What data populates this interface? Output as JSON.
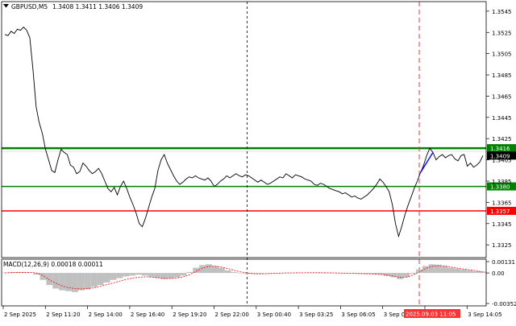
{
  "symbol_info": "GBPUSD,M5",
  "ohlc": "1.3408 1.3411 1.3406 1.3409",
  "macd_label": "MACD(12,26,9) 0.00018 0.00011",
  "colors": {
    "price": "#000000",
    "green_level": "#008000",
    "red_level": "#ff0000",
    "vline_red": "#ff3333",
    "vline_black": "#000000",
    "macd_hist": "#c0c0c0",
    "macd_signal": "#ff0000",
    "blue_segment": "#1a1aff",
    "axis_bg": "#ffffff"
  },
  "chart_data": [
    {
      "type": "line",
      "name": "price",
      "ylim": [
        1.3313,
        1.3554
      ],
      "y_ticks": [
        "1.3545",
        "1.3525",
        "1.3505",
        "1.3485",
        "1.3465",
        "1.3445",
        "1.3425",
        "1.3405",
        "1.3385",
        "1.3365",
        "1.3345",
        "1.3325"
      ],
      "x_ticks": [
        "2 Sep 2025",
        "2 Sep 11:20",
        "2 Sep 14:00",
        "2 Sep 16:40",
        "2 Sep 19:20",
        "2 Sep 22:00",
        "3 Sep 00:40",
        "3 Sep 03:25",
        "3 Sep 06:05",
        "3 Sep 08:45",
        "3 Sep 11:25",
        "3 Sep 14:05"
      ],
      "current_time_label": "2025.09.03 11:05",
      "levels": [
        {
          "label": "1.3416",
          "value": 1.3416,
          "color": "green"
        },
        {
          "label": "1.3380",
          "value": 1.338,
          "color": "green"
        },
        {
          "label": "1.3357",
          "value": 1.3357,
          "color": "red"
        }
      ],
      "current_price_label": "1.3409",
      "close_values": [
        1.3523,
        1.3522,
        1.3526,
        1.3524,
        1.3528,
        1.3527,
        1.353,
        1.3527,
        1.352,
        1.349,
        1.3455,
        1.344,
        1.343,
        1.3415,
        1.3405,
        1.3395,
        1.3393,
        1.3405,
        1.3415,
        1.3412,
        1.341,
        1.34,
        1.3398,
        1.3392,
        1.3394,
        1.3402,
        1.3399,
        1.3395,
        1.3392,
        1.3394,
        1.3397,
        1.3392,
        1.3385,
        1.3378,
        1.3375,
        1.3379,
        1.3372,
        1.338,
        1.3385,
        1.3378,
        1.337,
        1.3363,
        1.3355,
        1.3345,
        1.3342,
        1.335,
        1.336,
        1.337,
        1.3378,
        1.3395,
        1.3405,
        1.341,
        1.3402,
        1.3396,
        1.339,
        1.3385,
        1.3382,
        1.3384,
        1.3387,
        1.3389,
        1.3388,
        1.339,
        1.3388,
        1.3387,
        1.3386,
        1.3388,
        1.3385,
        1.338,
        1.3382,
        1.3385,
        1.3387,
        1.339,
        1.3388,
        1.339,
        1.3392,
        1.339,
        1.3389,
        1.3391,
        1.339,
        1.3388,
        1.3386,
        1.3384,
        1.3386,
        1.3384,
        1.3382,
        1.3383,
        1.3385,
        1.3387,
        1.3389,
        1.3388,
        1.3392,
        1.339,
        1.3388,
        1.3391,
        1.339,
        1.3389,
        1.3387,
        1.3386,
        1.3385,
        1.3382,
        1.3381,
        1.3383,
        1.3382,
        1.338,
        1.3378,
        1.3377,
        1.3376,
        1.3375,
        1.3373,
        1.3374,
        1.3372,
        1.337,
        1.3371,
        1.3369,
        1.3368,
        1.337,
        1.3372,
        1.3375,
        1.3378,
        1.3382,
        1.3387,
        1.3384,
        1.338,
        1.3375,
        1.3363,
        1.3345,
        1.3333,
        1.3342,
        1.3353,
        1.3362,
        1.337,
        1.3378,
        1.3385,
        1.3393,
        1.34,
        1.3409,
        1.3416,
        1.3412,
        1.3405,
        1.3408,
        1.341,
        1.3407,
        1.3409,
        1.341,
        1.3406,
        1.3404,
        1.3409,
        1.341,
        1.3399,
        1.3402,
        1.3398,
        1.34,
        1.3403,
        1.3409
      ],
      "blue_segment": {
        "from_index": 133,
        "to_index": 137
      }
    },
    {
      "type": "line",
      "name": "MACD(12,26,9)",
      "ylim": [
        -0.00352,
        0.00131
      ],
      "y_ticks": [
        "0.00131",
        "0.00",
        "-0.00352"
      ],
      "histogram": [
        5e-05,
        8e-05,
        0.0001,
        9e-05,
        7e-05,
        -0.0002,
        -0.0008,
        -0.0014,
        -0.0018,
        -0.002,
        -0.0021,
        -0.0022,
        -0.002,
        -0.0019,
        -0.0016,
        -0.0014,
        -0.0011,
        -0.0008,
        -0.0006,
        -0.0004,
        -0.0003,
        -0.0002,
        -0.0003,
        -0.00045,
        -0.0006,
        -0.0007,
        -0.00065,
        -0.0005,
        -0.0003,
        0.0001,
        0.0006,
        0.0009,
        0.001,
        0.0008,
        0.0006,
        0.0003,
        0.0001,
        -5e-05,
        -0.0001,
        -0.00012,
        -8e-05,
        -5e-05,
        -2e-05,
        0.0,
        2e-05,
        1e-05,
        2e-05,
        3e-05,
        4e-05,
        3e-05,
        2e-05,
        0.0,
        -2e-05,
        -4e-05,
        -6e-05,
        -8e-05,
        -0.0001,
        -0.00012,
        -0.00015,
        -0.0002,
        -0.00035,
        -0.0005,
        -0.0007,
        -0.0005,
        -0.0001,
        0.0004,
        0.0008,
        0.001,
        0.00095,
        0.0008,
        0.0006,
        0.0005,
        0.0004,
        0.0003,
        0.0002,
        0.00018
      ],
      "signal": [
        0.0,
        4e-05,
        6e-05,
        7e-05,
        6e-05,
        0.0,
        -0.0003,
        -0.0008,
        -0.0012,
        -0.0015,
        -0.0017,
        -0.0018,
        -0.00185,
        -0.0018,
        -0.0017,
        -0.00155,
        -0.00135,
        -0.00115,
        -0.00095,
        -0.00075,
        -0.0006,
        -0.0005,
        -0.00045,
        -0.00048,
        -0.00055,
        -0.00062,
        -0.00064,
        -0.00058,
        -0.00045,
        -0.0002,
        0.0002,
        0.00055,
        0.00075,
        0.00078,
        0.00068,
        0.0005,
        0.0003,
        0.00012,
        0.0,
        -8e-05,
        -0.0001,
        -9e-05,
        -6e-05,
        -3e-05,
        0.0,
        1e-05,
        2e-05,
        2e-05,
        3e-05,
        3e-05,
        3e-05,
        2e-05,
        0.0,
        -2e-05,
        -4e-05,
        -6e-05,
        -8e-05,
        -0.0001,
        -0.00012,
        -0.00016,
        -0.00025,
        -0.00038,
        -0.00052,
        -0.00048,
        -0.00025,
        0.0001,
        0.0005,
        0.00075,
        0.00085,
        0.0008,
        0.00068,
        0.00056,
        0.00045,
        0.00035,
        0.00025,
        0.00011
      ]
    }
  ]
}
